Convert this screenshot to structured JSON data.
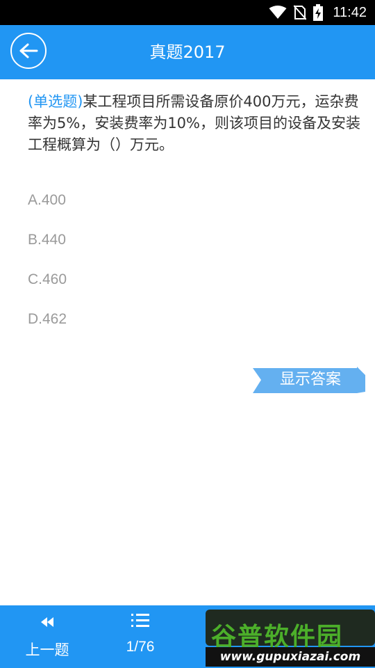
{
  "status": {
    "time": "11:42"
  },
  "header": {
    "title": "真题2017"
  },
  "question": {
    "type_label": "(单选题)",
    "text": "某工程项目所需设备原价400万元，运杂费率为5%，安装费率为10%，则该项目的设备及安装工程概算为（）万元。"
  },
  "options": [
    {
      "label": "A.400"
    },
    {
      "label": "B.440"
    },
    {
      "label": "C.460"
    },
    {
      "label": "D.462"
    }
  ],
  "show_answer": {
    "label": "显示答案"
  },
  "footer": {
    "prev_label": "上一题",
    "page_indicator": "1/76"
  },
  "watermark": {
    "title": "谷普软件园",
    "url": "www.gupuxiazai.com"
  },
  "colors": {
    "primary": "#2196F3",
    "button": "#64B0F0"
  }
}
